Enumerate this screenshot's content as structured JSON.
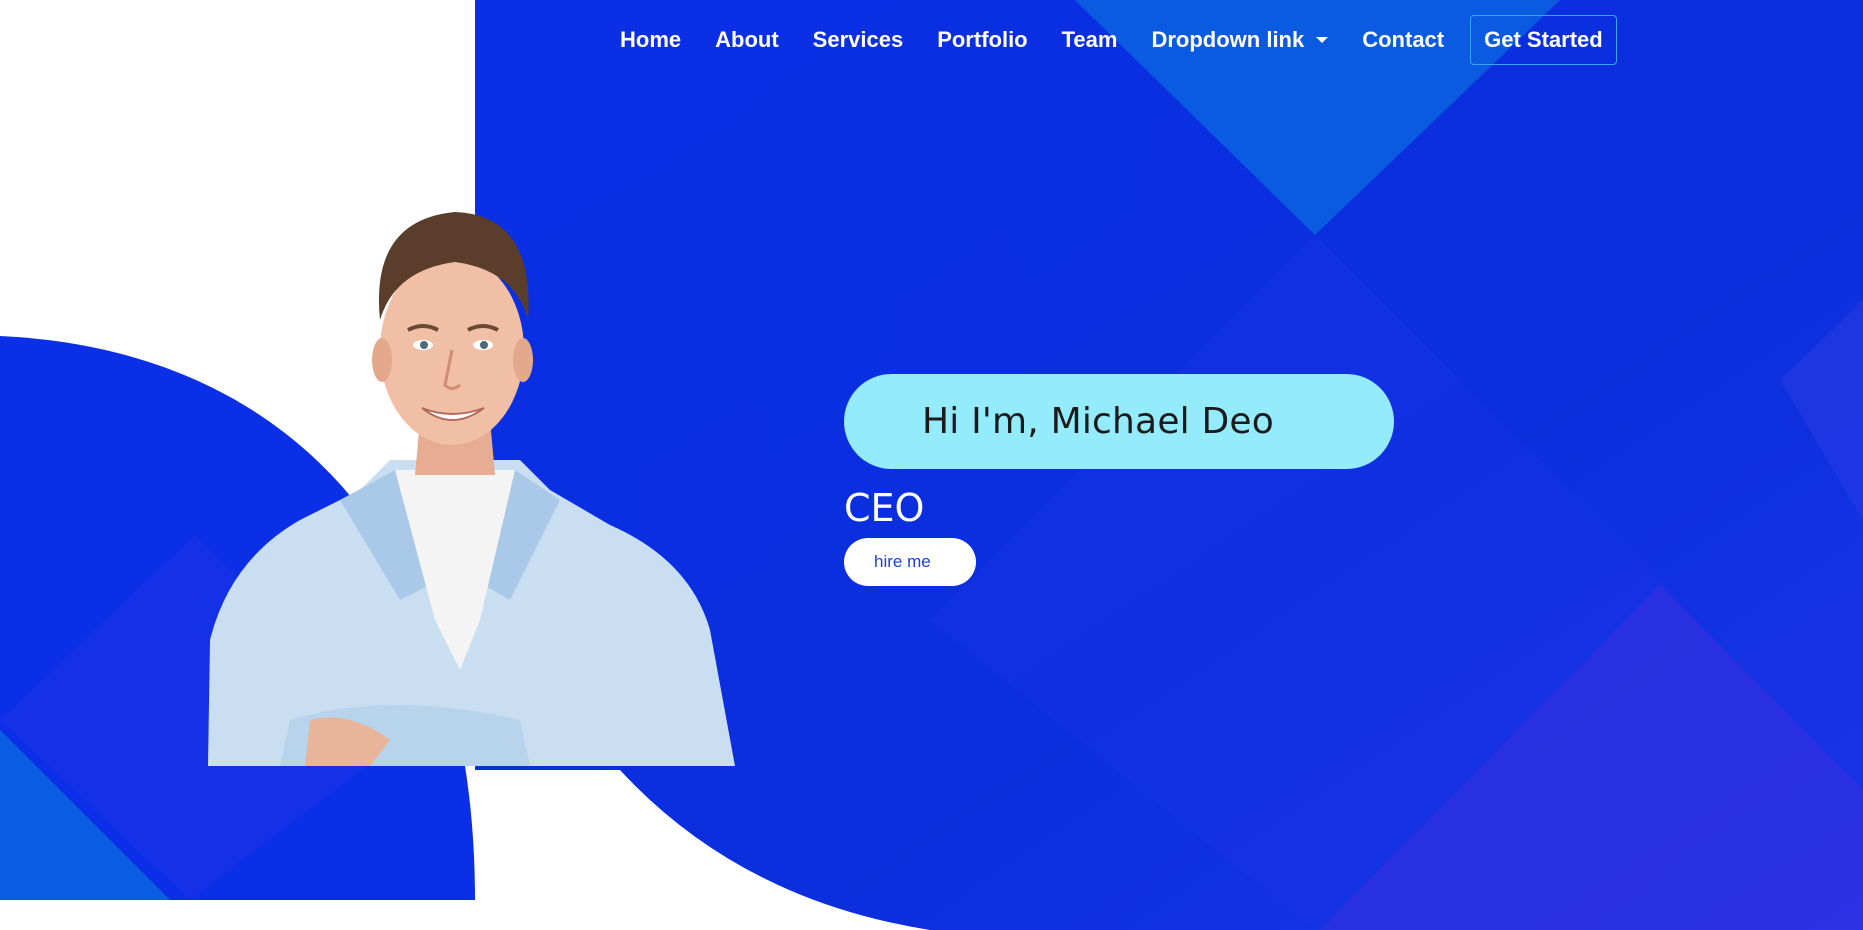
{
  "colors": {
    "hero_blue": "#0a30e4",
    "accent_light_blue": "#94ebfb",
    "button_border": "#36a3ff",
    "hire_text": "#1e3fd6"
  },
  "nav": {
    "items": [
      {
        "label": "Home"
      },
      {
        "label": "About"
      },
      {
        "label": "Services"
      },
      {
        "label": "Portfolio"
      },
      {
        "label": "Team"
      },
      {
        "label": "Dropdown link",
        "icon": "caret-down-icon"
      },
      {
        "label": "Contact"
      }
    ],
    "cta_label": "Get Started"
  },
  "hero": {
    "greeting": "Hi I'm, Michael Deo",
    "role": "CEO",
    "button_label": "hire me"
  },
  "portrait": {
    "icon": "profile-photo"
  }
}
